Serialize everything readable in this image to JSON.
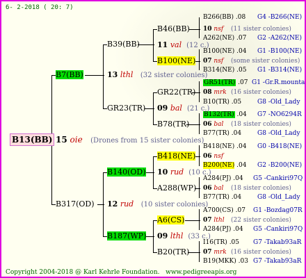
{
  "header": {
    "date": "6-  2-2018 ( 20: 7)"
  },
  "footer": {
    "copyright": "Copyright 2004-2018 @ Karl Kehrle Foundation.",
    "website": "www.pedigreeapis.org"
  },
  "root": {
    "name": "B13(BB)",
    "year": "15",
    "code": "oie",
    "desc": "(Drones from 15 sister colonies)"
  },
  "sire_top": {
    "name": "B39(BB)",
    "year": "13",
    "code": "lthl",
    "desc": "(32 sister colonies)"
  },
  "sire_bottom": {
    "name": "B317(OD)",
    "year": "12",
    "code": "rud",
    "desc": "(10 sister colonies)"
  },
  "queen_top": {
    "name": "B7(BB)"
  },
  "nodes": {
    "b46": "B46(BB)",
    "b46_year": "11",
    "b46_code": "val",
    "b46_desc": "(12 c.)",
    "b100": "B100(NE)",
    "gr22": "GR22(TR)",
    "gr22_year": "09",
    "gr22_code": "bal",
    "gr22_desc": "(21 c.)",
    "gr23": "GR23(TR)",
    "b78": "B78(TR)",
    "b140": "B140(OD)",
    "b418": "B418(NE)",
    "a288": "A288(WP)",
    "a288_year": "10",
    "a288_code": "rud",
    "a288_desc": "(10 c.)",
    "b187": "B187(WP)",
    "a6": "A6(CS)",
    "b20": "B20(TR)",
    "b20_year": "09",
    "b20_code": "lthl",
    "b20_desc": "(33 c.)"
  },
  "leaves": [
    {
      "name": "B266(BB)",
      "year": ".08",
      "ref": "G4 -B266(NE)"
    },
    {
      "name": "10",
      "year": "nsf",
      "ref": "(11 sister colonies)"
    },
    {
      "name": "A262(NE)",
      "year": ".07",
      "ref": "G2 -A262(NE)"
    },
    {
      "name": "B100(NE)",
      "year": ".04",
      "ref": "G1 -B100(NE)"
    },
    {
      "name": "07",
      "year": "nsf",
      "ref": "(some sister colonies)"
    },
    {
      "name": "B314(NE)",
      "year": ".05",
      "ref": "G1 -B314(NE)"
    },
    {
      "name": "GR51(TR)",
      "year": ".07",
      "ref": "G1 -Gr.R.mounta"
    },
    {
      "name": "08",
      "year": "mrk",
      "ref": "(16 sister colonies)"
    },
    {
      "name": "B10(TR)",
      "year": ".05",
      "ref": "G8 -Old_Lady"
    },
    {
      "name": "B132(TR)",
      "year": ".04",
      "ref": "G7 -NO6294R"
    },
    {
      "name": "06",
      "year": "bal",
      "ref": "(18 sister colonies)"
    },
    {
      "name": "B77(TR)",
      "year": ".04",
      "ref": "G8 -Old_Lady"
    },
    {
      "name": "B418(NE)",
      "year": ".04",
      "ref": "G0 -B418(NE)"
    },
    {
      "name": "06",
      "year": "nsf",
      "ref": ""
    },
    {
      "name": "B200(NE)",
      "year": ".04",
      "ref": "G2 -B200(NE)"
    },
    {
      "name": "A284(PJ)",
      "year": ".04",
      "ref": "G5 -Cankiri97Q"
    },
    {
      "name": "06",
      "year": "bal",
      "ref": "(18 sister colonies)"
    },
    {
      "name": "B77(TR)",
      "year": ".04",
      "ref": "G8 -Old_Lady"
    },
    {
      "name": "A700(CS)",
      "year": ".07",
      "ref": "G1 -Bozdag07R"
    },
    {
      "name": "07",
      "year": "lthl",
      "ref": "(22 sister colonies)"
    },
    {
      "name": "A284(PJ)",
      "year": ".04",
      "ref": "G5 -Cankiri97Q"
    },
    {
      "name": "I16(TR)",
      "year": ".05",
      "ref": "G7 -Takab93aR"
    },
    {
      "name": "07",
      "year": "mrk",
      "ref": "(16 sister colonies)"
    },
    {
      "name": "B19(MKK)",
      "year": ".03",
      "ref": "G7 -Takab93aR"
    }
  ]
}
